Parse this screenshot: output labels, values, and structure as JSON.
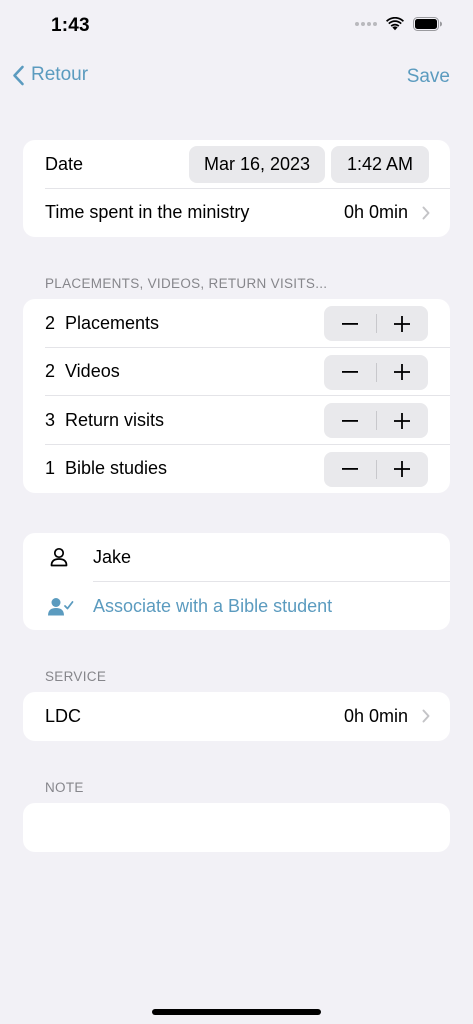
{
  "status_bar": {
    "time": "1:43",
    "icons": [
      "signal-dots-icon",
      "wifi-icon",
      "battery-icon"
    ]
  },
  "nav": {
    "back_label": "Retour",
    "save_label": "Save",
    "accent_color": "#5b9bbf"
  },
  "date_card": {
    "date_label": "Date",
    "date_value": "Mar 16, 2023",
    "time_value": "1:42 AM",
    "ministry_label": "Time spent in the ministry",
    "ministry_value": "0h 0min"
  },
  "placements_section": {
    "header": "PLACEMENTS, VIDEOS, RETURN VISITS...",
    "rows": [
      {
        "count": "2",
        "label": "Placements"
      },
      {
        "count": "2",
        "label": "Videos"
      },
      {
        "count": "3",
        "label": "Return visits"
      },
      {
        "count": "1",
        "label": "Bible studies"
      }
    ]
  },
  "person_card": {
    "name": "Jake",
    "associate_label": "Associate with a Bible student"
  },
  "service_section": {
    "header": "SERVICE",
    "label": "LDC",
    "value": "0h 0min"
  },
  "note_section": {
    "header": "NOTE",
    "value": ""
  }
}
